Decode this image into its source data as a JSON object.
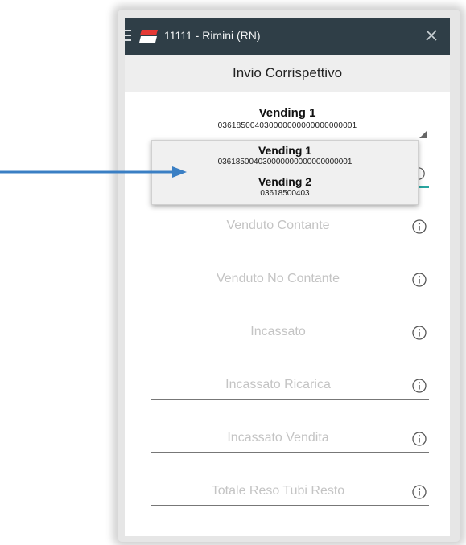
{
  "window": {
    "title": "11111 - Rimini (RN)"
  },
  "header": {
    "title": "Invio Corrispettivo"
  },
  "device_select": {
    "selected_name": "Vending 1",
    "selected_code": "036185004030000000000000000001"
  },
  "dropdown": {
    "options": [
      {
        "name": "Vending 1",
        "code": "036185004030000000000000000001"
      },
      {
        "name": "Vending 2",
        "code": "03618500403"
      }
    ]
  },
  "fields": [
    {
      "label": "Venduto Contante"
    },
    {
      "label": "Venduto No Contante"
    },
    {
      "label": "Incassato"
    },
    {
      "label": "Incassato Ricarica"
    },
    {
      "label": "Incassato Vendita"
    },
    {
      "label": "Totale Reso Tubi Resto"
    }
  ],
  "colors": {
    "titlebar": "#2f3e47",
    "accent_underline": "#2aa6a0",
    "flag_red": "#e53935",
    "arrow": "#3a7fc4"
  },
  "icons": {
    "menu": "hamburger-icon",
    "logo": "flag-icon",
    "close": "close-icon",
    "info": "info-icon",
    "dropdown": "triangle-icon"
  }
}
